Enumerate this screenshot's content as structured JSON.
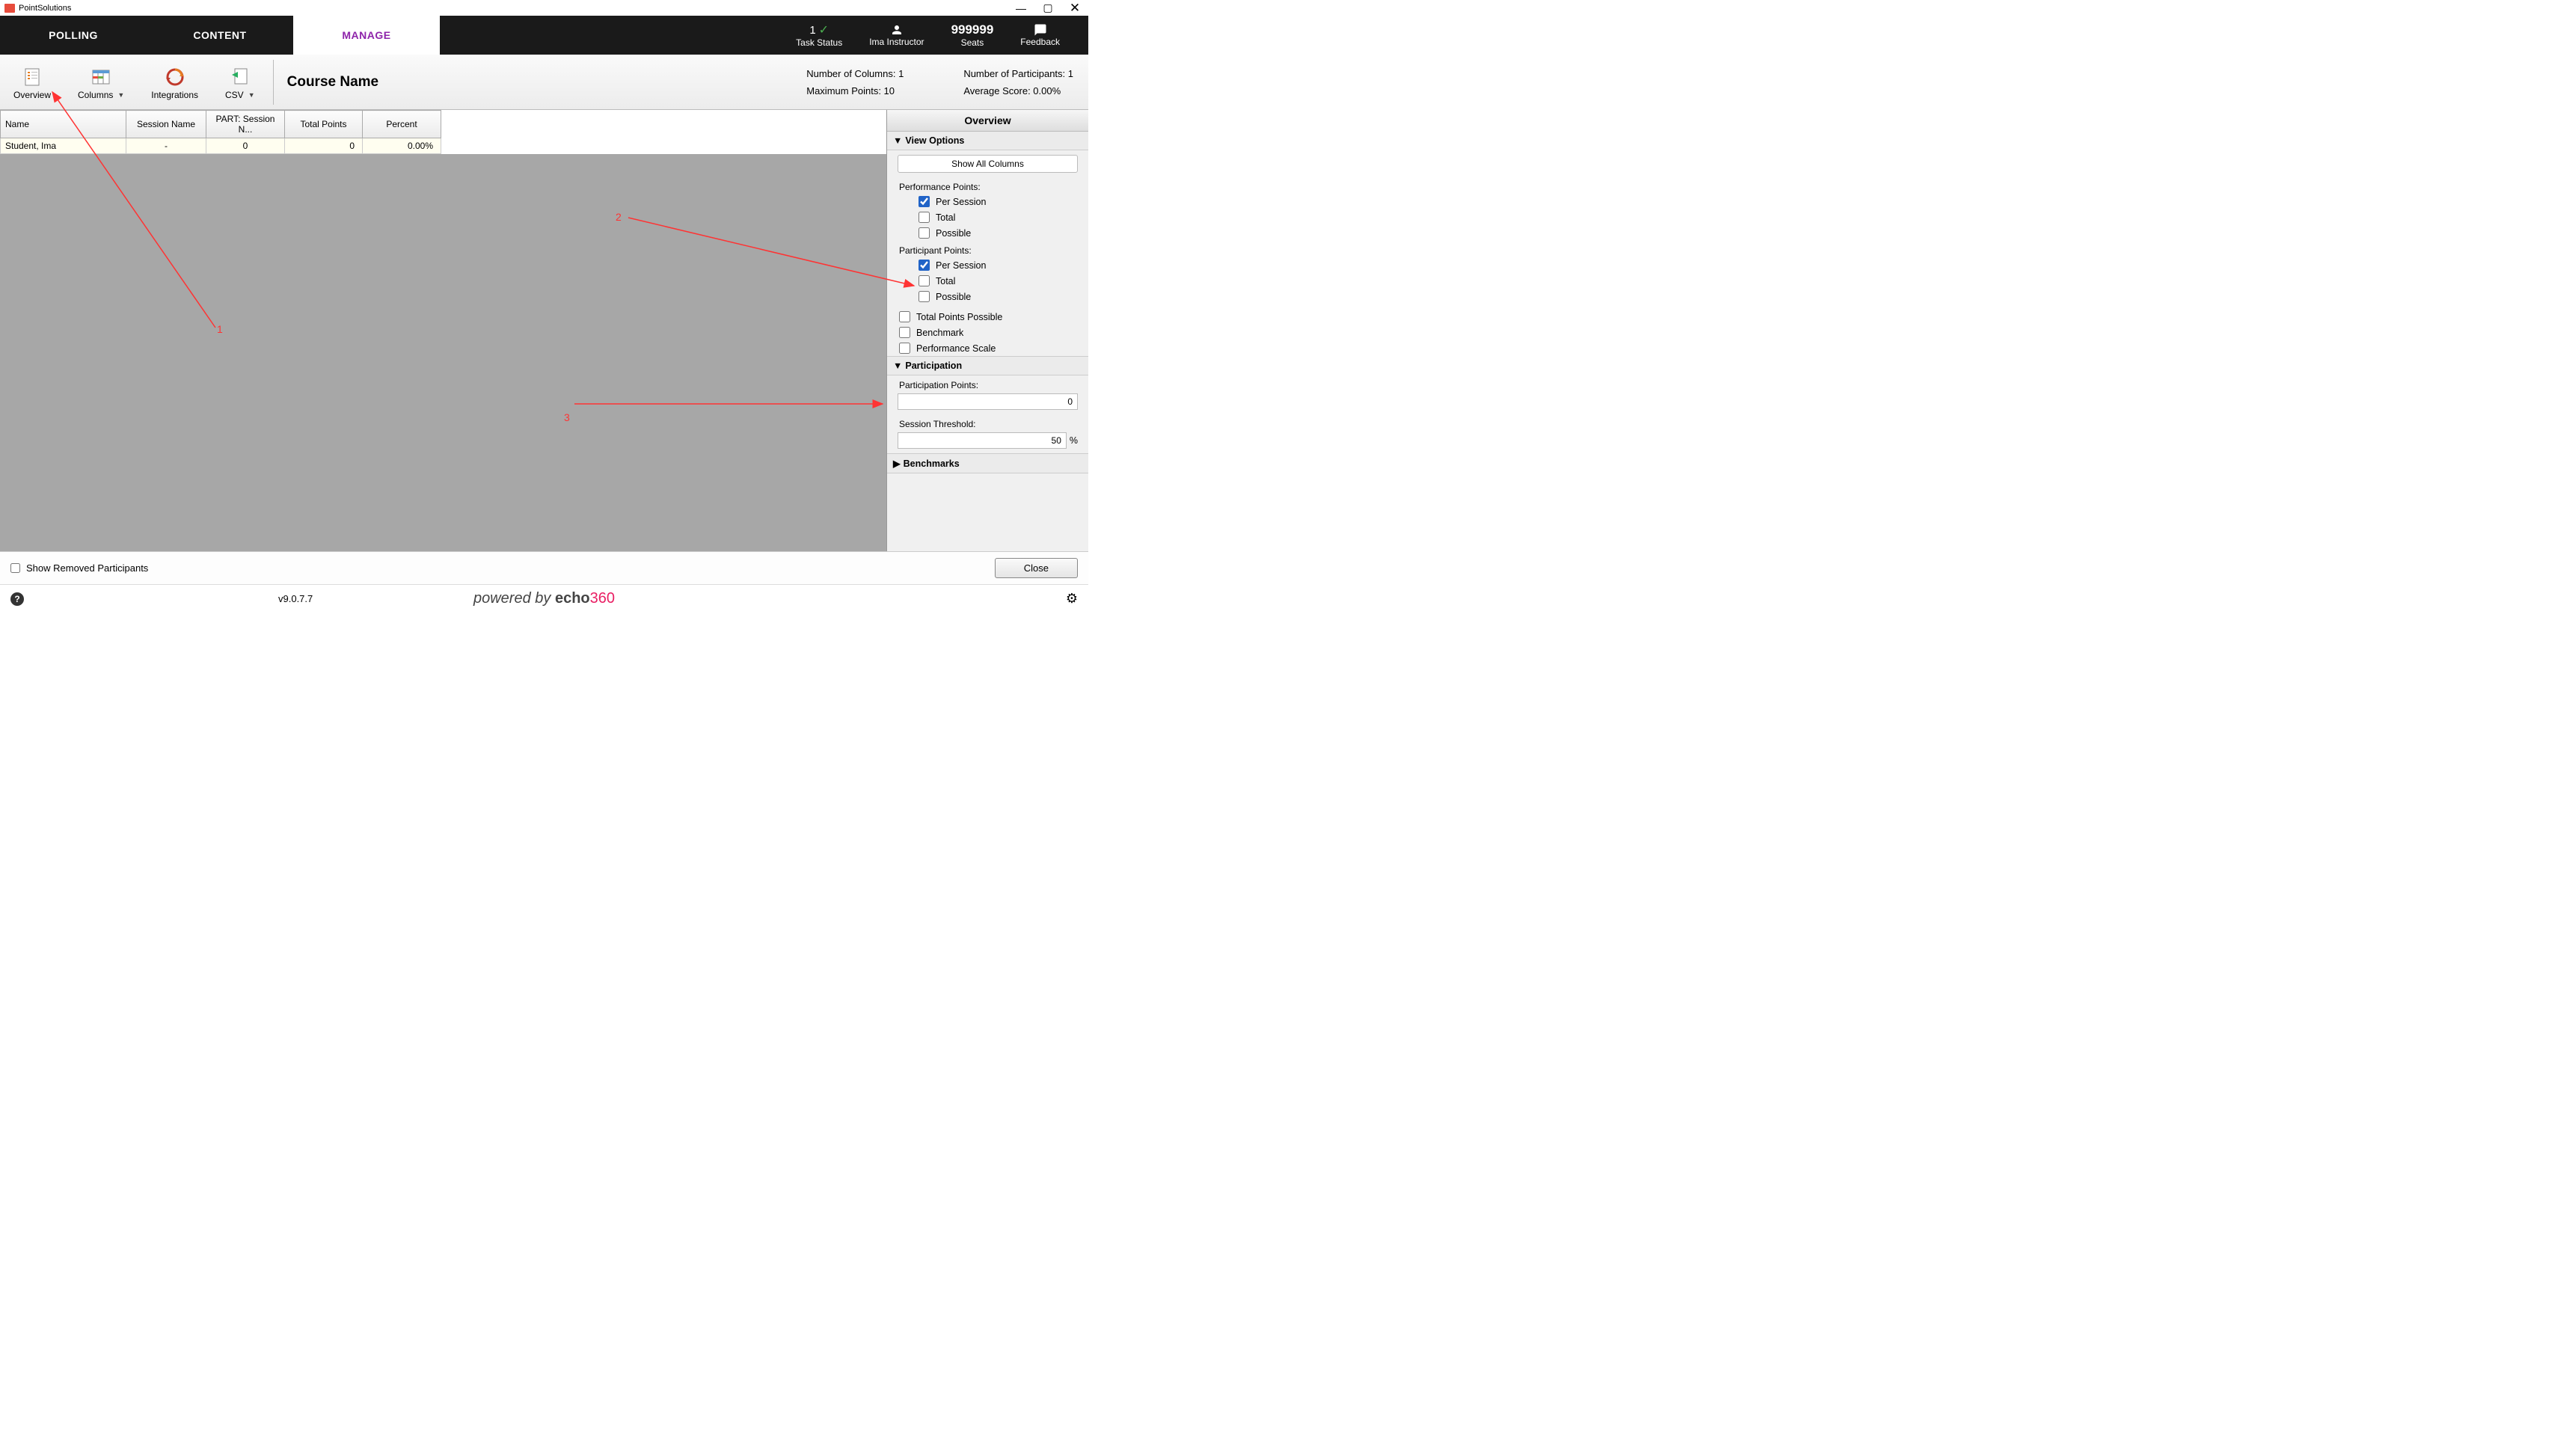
{
  "app": {
    "title": "PointSolutions"
  },
  "nav": {
    "tabs": [
      "POLLING",
      "CONTENT",
      "MANAGE"
    ],
    "task_status": {
      "count": "1",
      "label": "Task Status"
    },
    "user": {
      "name": "Ima Instructor"
    },
    "seats": {
      "value": "999999",
      "label": "Seats"
    },
    "feedback": {
      "label": "Feedback"
    }
  },
  "toolbar": {
    "overview": "Overview",
    "columns": "Columns",
    "integrations": "Integrations",
    "csv": "CSV",
    "course_name": "Course Name"
  },
  "stats": {
    "num_columns": "Number of Columns: 1",
    "max_points": "Maximum Points: 10",
    "num_participants": "Number of Participants: 1",
    "avg_score": "Average Score: 0.00%"
  },
  "grid": {
    "headers": [
      "Name",
      "Session Name",
      "PART: Session N...",
      "Total Points",
      "Percent"
    ],
    "rows": [
      {
        "name": "Student, Ima",
        "session": "-",
        "part": "0",
        "total": "0",
        "percent": "0.00%"
      }
    ]
  },
  "sidepanel": {
    "title": "Overview",
    "view_options": "View Options",
    "show_all": "Show All Columns",
    "perf_points": "Performance Points:",
    "part_points": "Participant Points:",
    "per_session": "Per Session",
    "total": "Total",
    "possible": "Possible",
    "total_points_possible": "Total Points Possible",
    "benchmark": "Benchmark",
    "perf_scale": "Performance Scale",
    "participation": "Participation",
    "participation_points": "Participation Points:",
    "participation_points_val": "0",
    "session_threshold": "Session Threshold:",
    "session_threshold_val": "50",
    "percent_sign": "%",
    "benchmarks": "Benchmarks"
  },
  "bottom": {
    "show_removed": "Show Removed Participants",
    "close": "Close"
  },
  "footer": {
    "powered1": "powered by ",
    "powered2": "echo",
    "powered3": "360",
    "version": "v9.0.7.7"
  },
  "annotations": {
    "a1": "1",
    "a2": "2",
    "a3": "3"
  }
}
